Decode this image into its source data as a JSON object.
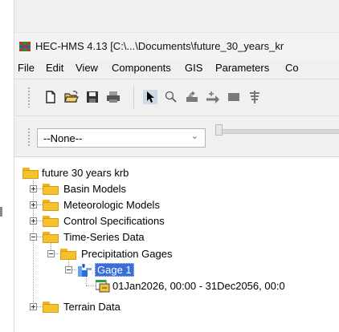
{
  "window": {
    "title": "HEC-HMS 4.13 [C:\\...\\Documents\\future_30_years_kr"
  },
  "menu": [
    "File",
    "Edit",
    "View",
    "Components",
    "GIS",
    "Parameters",
    "Co"
  ],
  "toolbar": {
    "icons": [
      "new-file-icon",
      "open-folder-icon",
      "save-icon",
      "print-icon",
      "pointer-arrow-icon",
      "zoom-icon",
      "add-subbasin-icon",
      "add-reach-icon",
      "add-reservoir-icon",
      "add-junction-icon"
    ]
  },
  "combo": {
    "selected": "--None--"
  },
  "tree": {
    "root": "future 30 years krb",
    "basin_models": "Basin Models",
    "met_models": "Meteorologic Models",
    "control_specs": "Control Specifications",
    "time_series": "Time-Series Data",
    "precip_gages": "Precipitation Gages",
    "gage": "Gage 1",
    "gage_window": "01Jan2026, 00:00 - 31Dec2056, 00:0",
    "terrain": "Terrain Data"
  },
  "colors": {
    "folder": "#f6c22b",
    "selection": "#3a6ed8"
  }
}
